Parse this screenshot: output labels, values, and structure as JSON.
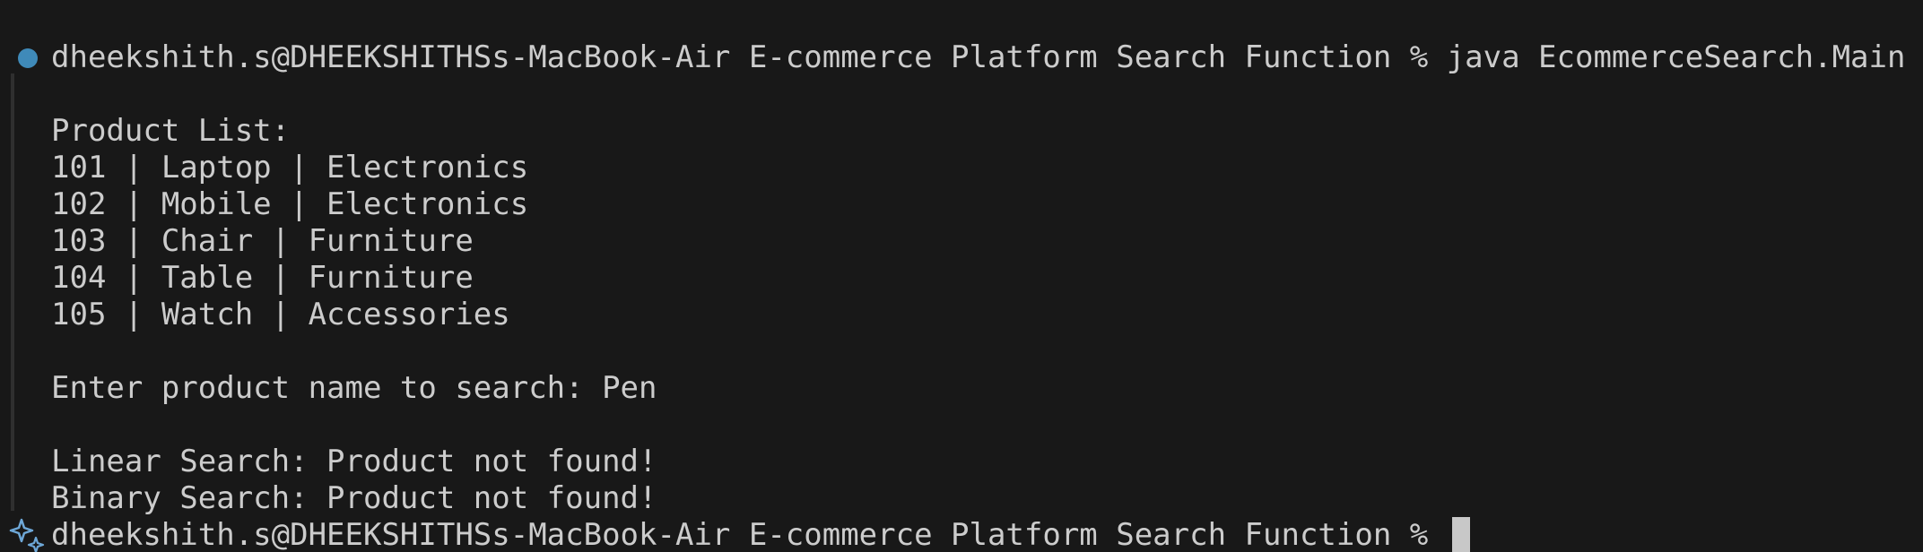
{
  "terminal": {
    "prompt_command": "dheekshith.s@DHEEKSHITHSs-MacBook-Air E-commerce Platform Search Function % java EcommerceSearch.Main",
    "product_list_header": "Product List:",
    "products": [
      "101 | Laptop | Electronics",
      "102 | Mobile | Electronics",
      "103 | Chair | Furniture",
      "104 | Table | Furniture",
      "105 | Watch | Accessories"
    ],
    "search_prompt": "Enter product name to search: Pen",
    "linear_result": "Linear Search: Product not found!",
    "binary_result": "Binary Search: Product not found!",
    "final_prompt": "dheekshith.s@DHEEKSHITHSs-MacBook-Air E-commerce Platform Search Function % "
  },
  "colors": {
    "background": "#181818",
    "text": "#cccccc",
    "status_dot": "#3f8ab9",
    "sparkle": "#6ea8d8"
  },
  "icons": {
    "status": "command-status-dot-icon",
    "prompt": "sparkle-icon"
  }
}
